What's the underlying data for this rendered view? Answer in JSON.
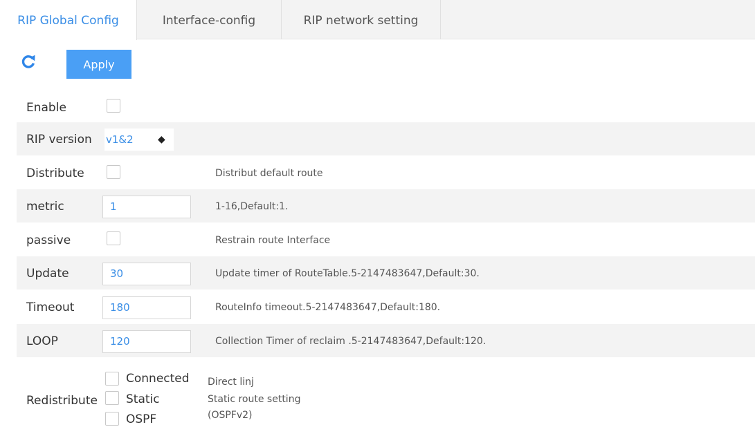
{
  "tabs": [
    {
      "label": "RIP Global Config",
      "active": true
    },
    {
      "label": "Interface-config",
      "active": false
    },
    {
      "label": "RIP network setting",
      "active": false
    }
  ],
  "toolbar": {
    "refresh_icon": "refresh-icon",
    "apply_label": "Apply"
  },
  "form": {
    "enable": {
      "label": "Enable",
      "checked": false
    },
    "rip_version": {
      "label": "RIP version",
      "value": "v1&2"
    },
    "distribute": {
      "label": "Distribute",
      "checked": false,
      "hint": "Distribut default route"
    },
    "metric": {
      "label": "metric",
      "value": "1",
      "hint": "1-16,Default:1."
    },
    "passive": {
      "label": "passive",
      "checked": false,
      "hint": "Restrain route Interface"
    },
    "update": {
      "label": "Update",
      "value": "30",
      "hint": "Update timer of RouteTable.5-2147483647,Default:30."
    },
    "timeout": {
      "label": "Timeout",
      "value": "180",
      "hint": "RouteInfo timeout.5-2147483647,Default:180."
    },
    "loop": {
      "label": "LOOP",
      "value": "120",
      "hint": "Collection Timer of reclaim .5-2147483647,Default:120."
    },
    "redistribute": {
      "label": "Redistribute",
      "options": [
        {
          "label": "Connected",
          "checked": false,
          "hint": "Direct linj"
        },
        {
          "label": "Static",
          "checked": false,
          "hint": "Static route setting"
        },
        {
          "label": "OSPF",
          "checked": false,
          "hint": "(OSPFv2)"
        }
      ]
    }
  },
  "colors": {
    "accent": "#3a8ee6",
    "button": "#4a9ff5",
    "row_alt": "#f3f3f3",
    "tabbar": "#f3f3f3"
  }
}
